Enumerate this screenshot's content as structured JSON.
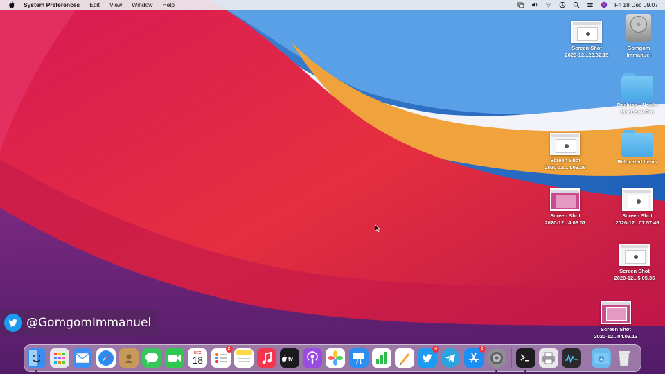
{
  "menubar": {
    "app_name": "System Preferences",
    "menus": [
      "Edit",
      "View",
      "Window",
      "Help"
    ],
    "status_icons": [
      "screen-mirroring-icon",
      "volume-icon",
      "wifi-icon",
      "time-machine-icon",
      "spotlight-search-icon",
      "control-center-icon",
      "siri-icon"
    ],
    "clock": "Fri 18 Dec  09.07"
  },
  "desktop": {
    "items": [
      {
        "label": "Screen Shot\n2020-12...22.32.15",
        "kind": "screenshot"
      },
      {
        "label": "Gomgom\nImmanuel",
        "kind": "hard-drive"
      },
      {
        "label": "Desktop - Noel's\nMacBook Pro",
        "kind": "folder"
      },
      {
        "label": "Screen Shot\n2020-12...4.03.06",
        "kind": "screenshot"
      },
      {
        "label": "Relocated Items",
        "kind": "folder-alias"
      },
      {
        "label": "Screen Shot\n2020-12...4.06.07",
        "kind": "screenshot"
      },
      {
        "label": "Screen Shot\n2020-12...07.57.45",
        "kind": "screenshot"
      },
      {
        "label": "Screen Shot\n2020-12...5.05.35",
        "kind": "screenshot"
      },
      {
        "label": "Screen Shot\n2020-12...04.03.13",
        "kind": "screenshot"
      }
    ]
  },
  "watermark": {
    "handle": "@GomgomImmanuel"
  },
  "dock": {
    "calendar": {
      "month": "DEC",
      "day": "18"
    },
    "apps": [
      {
        "name": "finder",
        "color": "#3b8df0",
        "running": true
      },
      {
        "name": "launchpad",
        "color": "#e9e9ee"
      },
      {
        "name": "mail",
        "color": "#3c8ff5"
      },
      {
        "name": "safari",
        "color": "#2b8cf0"
      },
      {
        "name": "contacts",
        "color": "#c59a5b"
      },
      {
        "name": "messages",
        "color": "#35c759"
      },
      {
        "name": "facetime",
        "color": "#2fc853"
      },
      {
        "name": "calendar",
        "color": "#ffffff"
      },
      {
        "name": "reminders",
        "color": "#ffffff",
        "badge": "2"
      },
      {
        "name": "notes",
        "color": "#ffd94a"
      },
      {
        "name": "music",
        "color": "#f6364f"
      },
      {
        "name": "apple-tv",
        "color": "#1b1b1d"
      },
      {
        "name": "podcasts",
        "color": "#9b4ce0"
      },
      {
        "name": "photos",
        "color": "#ffffff"
      },
      {
        "name": "keynote",
        "color": "#2a8ff0"
      },
      {
        "name": "numbers",
        "color": "#2fbb4e"
      },
      {
        "name": "pages",
        "color": "#f6a13a"
      },
      {
        "name": "twitter",
        "color": "#1d9bf0",
        "badge": "4"
      },
      {
        "name": "telegram",
        "color": "#2aa4e0"
      },
      {
        "name": "app-store",
        "color": "#1c8ef5",
        "badge": "2"
      },
      {
        "name": "system-preferences",
        "color": "#8e8e93",
        "running": true
      },
      {
        "name": "terminal",
        "color": "#1d1d1f",
        "running": true
      },
      {
        "name": "printer",
        "color": "#e8e8ea"
      },
      {
        "name": "activity-monitor",
        "color": "#2a2a2e"
      }
    ],
    "stacks": [
      {
        "name": "downloads-folder",
        "color": "#6ab8ee"
      },
      {
        "name": "trash",
        "color": "#e9e9ec"
      }
    ]
  }
}
